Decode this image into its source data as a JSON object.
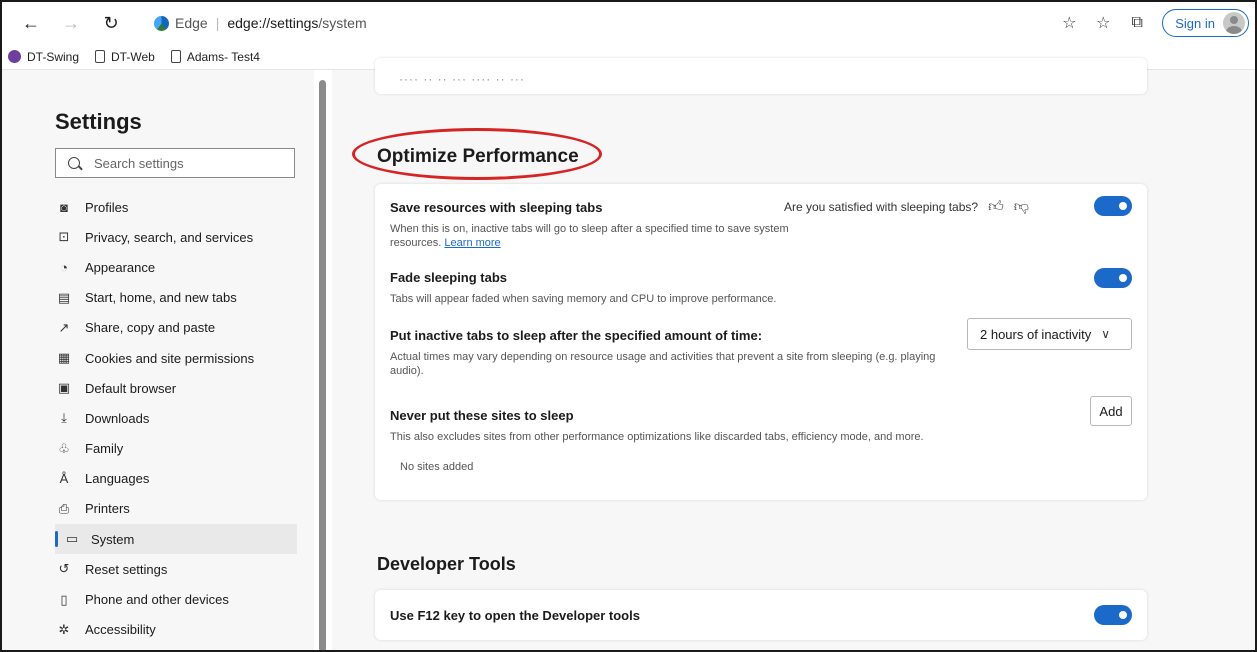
{
  "browser": {
    "edge_label": "Edge",
    "url_host": "edge://settings",
    "url_path": "/system",
    "sign_in": "Sign in"
  },
  "favorites": [
    {
      "label": "DT-Swing"
    },
    {
      "label": "DT-Web"
    },
    {
      "label": "Adams- Test4"
    }
  ],
  "sidebar": {
    "title": "Settings",
    "search_placeholder": "Search settings",
    "items": [
      {
        "label": "Profiles",
        "icon": "profile-icon"
      },
      {
        "label": "Privacy, search, and services",
        "icon": "lock-icon"
      },
      {
        "label": "Appearance",
        "icon": "appearance-icon"
      },
      {
        "label": "Start, home, and new tabs",
        "icon": "home-tab-icon"
      },
      {
        "label": "Share, copy and paste",
        "icon": "share-icon"
      },
      {
        "label": "Cookies and site permissions",
        "icon": "cookies-icon"
      },
      {
        "label": "Default browser",
        "icon": "default-browser-icon"
      },
      {
        "label": "Downloads",
        "icon": "download-icon"
      },
      {
        "label": "Family",
        "icon": "family-icon"
      },
      {
        "label": "Languages",
        "icon": "languages-icon"
      },
      {
        "label": "Printers",
        "icon": "printer-icon"
      },
      {
        "label": "System",
        "icon": "system-icon",
        "active": true
      },
      {
        "label": "Reset settings",
        "icon": "reset-icon"
      },
      {
        "label": "Phone and other devices",
        "icon": "phone-icon"
      },
      {
        "label": "Accessibility",
        "icon": "accessibility-icon"
      }
    ]
  },
  "main": {
    "performance": {
      "title": "Optimize Performance",
      "sleeping_tabs": {
        "title": "Save resources with sleeping tabs",
        "desc": "When this is on, inactive tabs will go to sleep after a specified time to save system resources.",
        "link": "Learn more",
        "feedback": "Are you satisfied with sleeping tabs?",
        "enabled": true
      },
      "fade_tabs": {
        "title": "Fade sleeping tabs",
        "desc": "Tabs will appear faded when saving memory and CPU to improve performance.",
        "enabled": true
      },
      "inactive_timer": {
        "title": "Put inactive tabs to sleep after the specified amount of time:",
        "desc": "Actual times may vary depending on resource usage and activities that prevent a site from sleeping (e.g. playing audio).",
        "selected": "2 hours of inactivity"
      },
      "never_sleep": {
        "title": "Never put these sites to sleep",
        "desc": "This also excludes sites from other performance optimizations like discarded tabs, efficiency mode, and more.",
        "add_label": "Add",
        "empty_text": "No sites added"
      }
    },
    "developer": {
      "title": "Developer Tools",
      "f12": {
        "title": "Use F12 key to open the Developer tools",
        "enabled": true
      }
    }
  },
  "colors": {
    "accent": "#1b6ac9",
    "highlight": "#d62424"
  }
}
